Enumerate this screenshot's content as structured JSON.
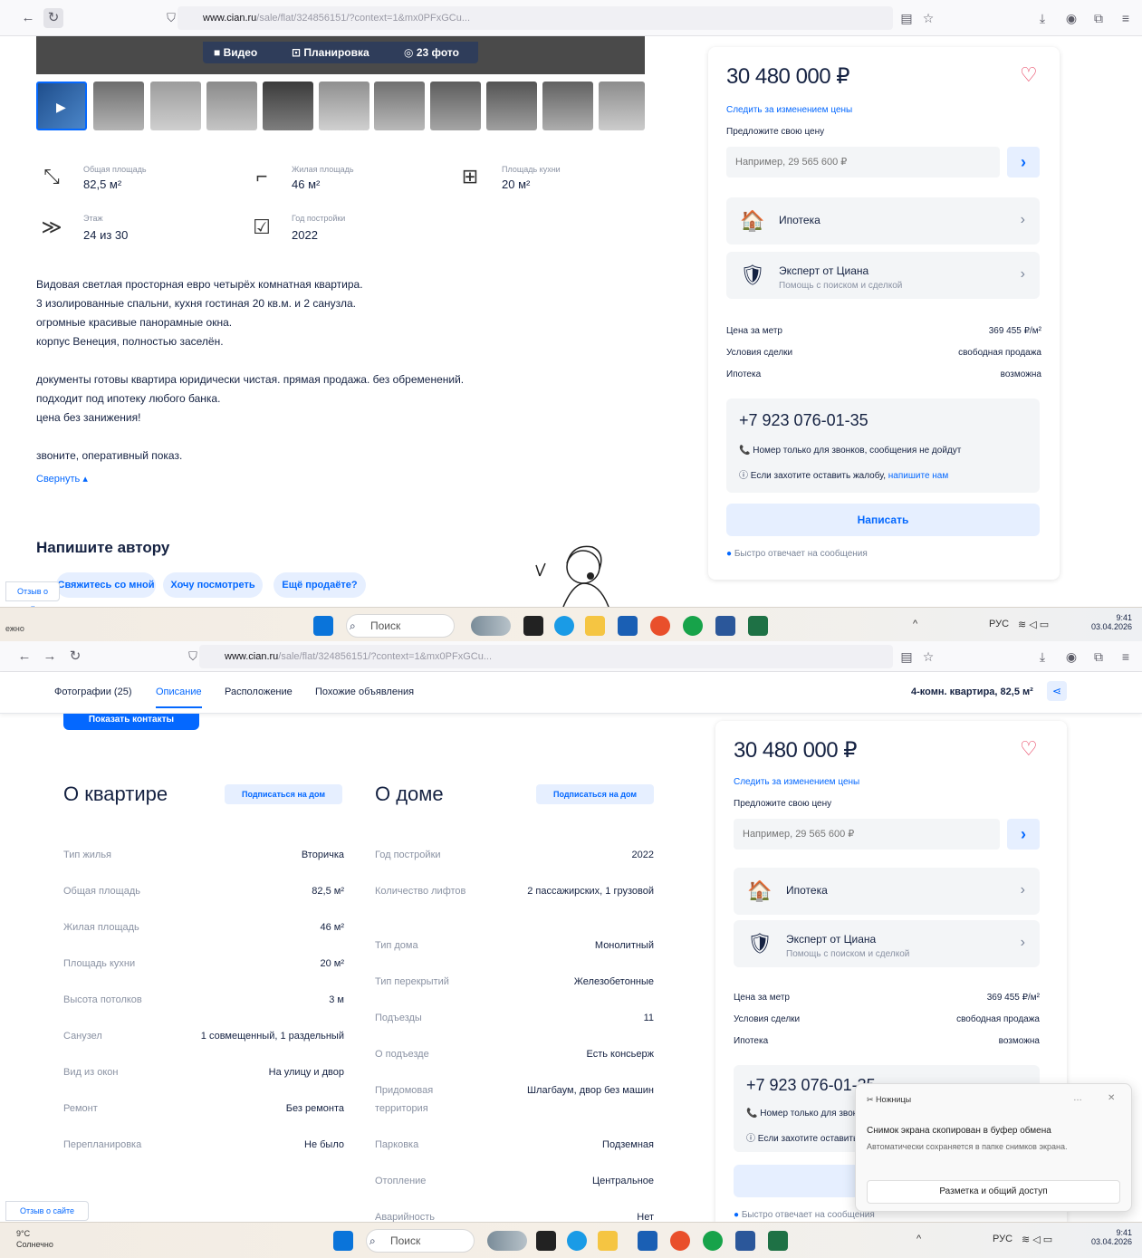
{
  "top_browser": {
    "url_domain": "www.cian.ru",
    "url_rest": "/sale/flat/324856151/?context=1&mx0PFxGCu..."
  },
  "gallery": {
    "tabs": [
      {
        "icon": "video-icon",
        "label": "Видео"
      },
      {
        "icon": "floorplan-icon",
        "label": "Планировка"
      },
      {
        "icon": "camera-icon",
        "label": "23 фото"
      }
    ]
  },
  "features": [
    {
      "label": "Общая площадь",
      "value": "82,5 м²"
    },
    {
      "label": "Жилая площадь",
      "value": "46 м²"
    },
    {
      "label": "Площадь кухни",
      "value": "20 м²"
    },
    {
      "label": "Этаж",
      "value": "24 из 30"
    },
    {
      "label": "Год постройки",
      "value": "2022"
    }
  ],
  "description": {
    "p1": [
      "Видовая светлая просторная евро четырёх комнатная квартира.",
      "3 изолированные спальни, кухня гостиная 20 кв.м. и 2 санузла.",
      "огромные красивые панорамные окна.",
      "корпус Венеция, полностью заселён."
    ],
    "p2": [
      "документы готовы квартира юридически чистая. прямая продажа. без обременений.",
      "подходит под ипотеку любого банка.",
      "цена без занижения!"
    ],
    "p3": [
      "звоните, оперативный показ."
    ],
    "collapse": "Свернуть"
  },
  "write_author": {
    "title": "Напишите автору",
    "chips": [
      "Свяжитесь со мной",
      "Хочу посмотреть",
      "Ещё продаёте?"
    ],
    "side_link": "Отзыв о сайте"
  },
  "card": {
    "price": "30 480 000 ₽",
    "track_link": "Следить за изменением цены",
    "offer_label": "Предложите свою цену",
    "offer_placeholder": "Например, 29 565 600 ₽",
    "mortgage": "Ипотека",
    "expert_title": "Эксперт от Циана",
    "expert_sub": "Помощь с поиском и сделкой",
    "rows": [
      {
        "k": "Цена за метр",
        "v": "369 455 ₽/м²"
      },
      {
        "k": "Условия сделки",
        "v": "свободная продажа"
      },
      {
        "k": "Ипотека",
        "v": "возможна"
      }
    ],
    "phone": "+7 923 076-01-35",
    "note1": "Номер только для звонков, сообщения не дойдут",
    "note2_pre": "Если захотите оставить жалобу,",
    "note2_link": "напишите нам",
    "write_btn": "Написать",
    "fast_reply": "Быстро отвечает на сообщения"
  },
  "taskbar": {
    "search": "Поиск",
    "lang": "РУС",
    "time": "9:41",
    "date": "03.04.2026",
    "weather_temp": "9°C",
    "weather_text": "Солнечно"
  },
  "page_tabs": [
    "Фотографии (25)",
    "Описание",
    "Расположение",
    "Похожие объявления"
  ],
  "page_header_right": "4-комн. квартира, 82,5 м²",
  "show_contacts": "Показать контакты",
  "flat": {
    "title": "О квартире",
    "subscribe": "Подписаться на дом",
    "rows": [
      {
        "k": "Тип жилья",
        "v": "Вторичка"
      },
      {
        "k": "Общая площадь",
        "v": "82,5 м²"
      },
      {
        "k": "Жилая площадь",
        "v": "46 м²"
      },
      {
        "k": "Площадь кухни",
        "v": "20 м²"
      },
      {
        "k": "Высота потолков",
        "v": "3 м"
      },
      {
        "k": "Санузел",
        "v": "1 совмещенный, 1 раздельный"
      },
      {
        "k": "Вид из окон",
        "v": "На улицу и двор"
      },
      {
        "k": "Ремонт",
        "v": "Без ремонта"
      },
      {
        "k": "Перепланировка",
        "v": "Не было"
      }
    ]
  },
  "house": {
    "title": "О доме",
    "subscribe": "Подписаться на дом",
    "rows": [
      {
        "k": "Год постройки",
        "v": "2022"
      },
      {
        "k": "Количество лифтов",
        "v": "2 пассажирских, 1 грузовой"
      },
      {
        "k": "Тип дома",
        "v": "Монолитный"
      },
      {
        "k": "Тип перекрытий",
        "v": "Железобетонные"
      },
      {
        "k": "Подъезды",
        "v": "11"
      },
      {
        "k": "О подъезде",
        "v": "Есть консьерж"
      },
      {
        "k": "Придомовая территория",
        "v": "Шлагбаум, двор без машин"
      },
      {
        "k": "Парковка",
        "v": "Подземная"
      },
      {
        "k": "Отопление",
        "v": "Центральное"
      },
      {
        "k": "Аварийность",
        "v": "Нет"
      }
    ]
  },
  "toast": {
    "app": "Ножницы",
    "title": "Снимок экрана скопирован в буфер обмена",
    "body": "Автоматически сохраняется в папке снимков экрана.",
    "action": "Разметка и общий доступ"
  },
  "colors": {
    "accent": "#0468ff",
    "accent_light": "#e6efff",
    "heart": "#e84260",
    "text": "#152242"
  }
}
